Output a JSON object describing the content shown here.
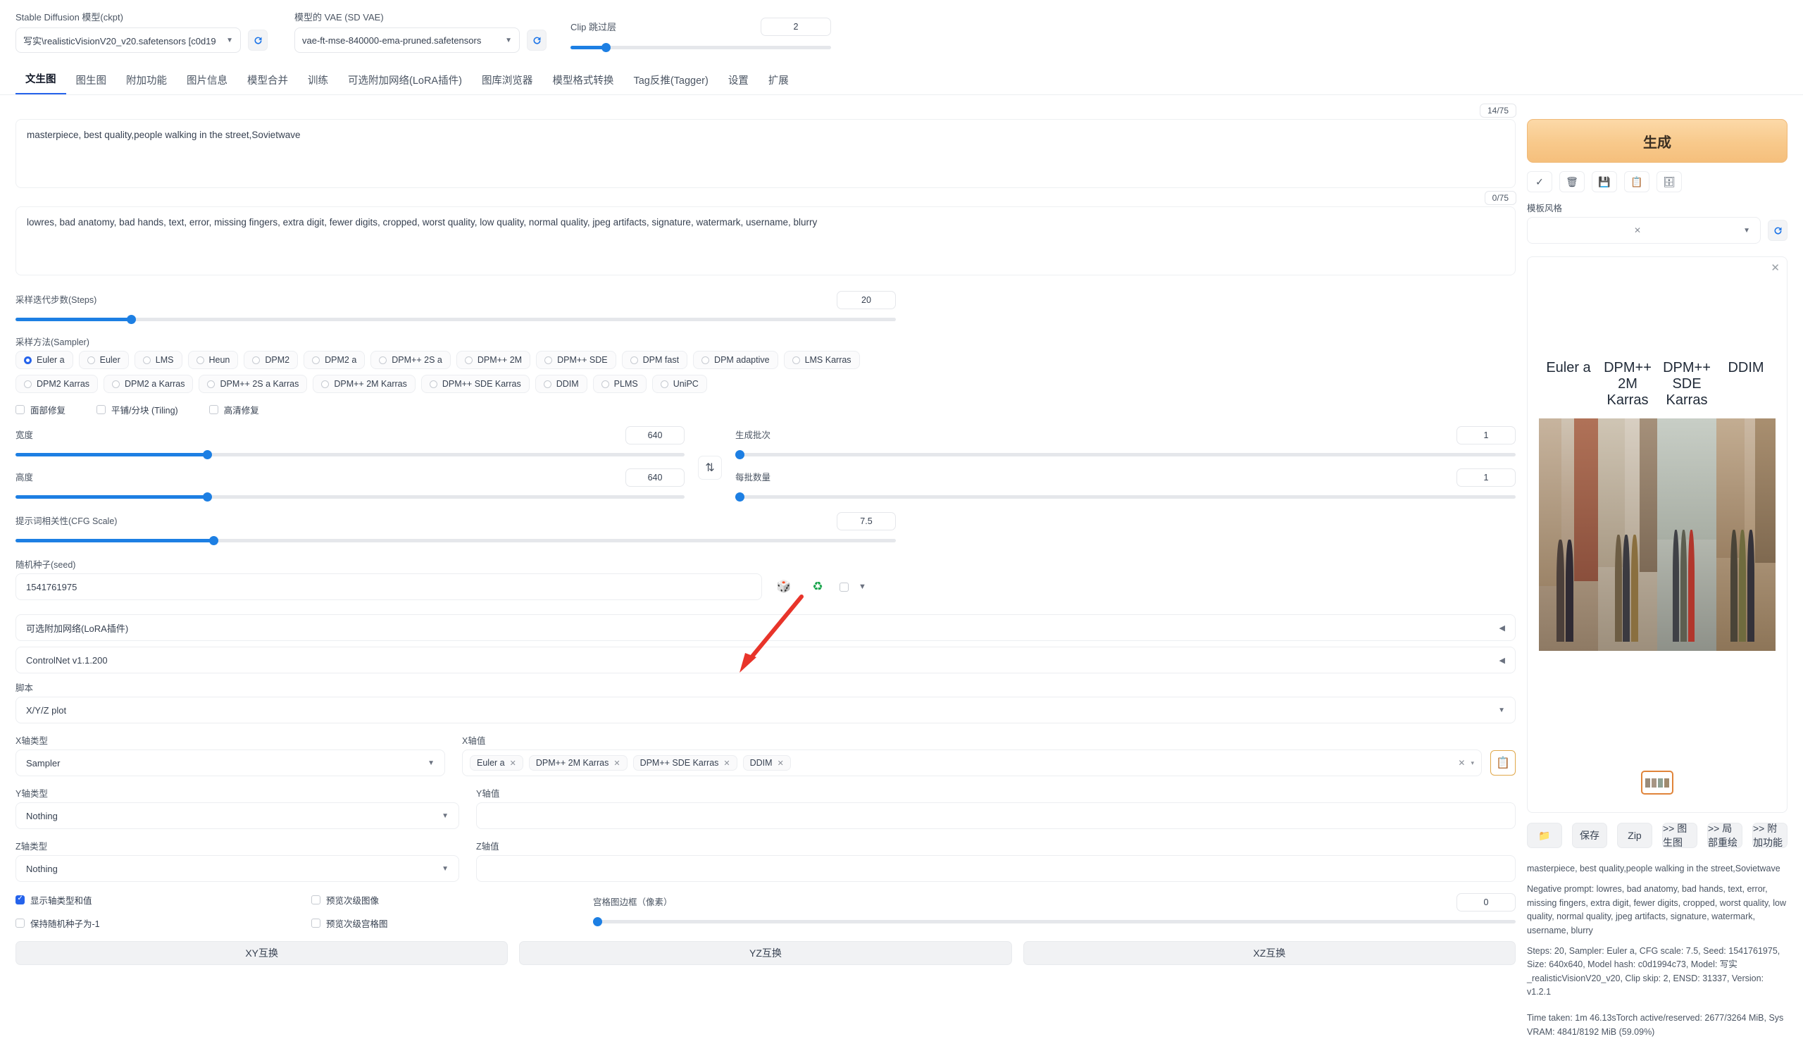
{
  "header": {
    "ckpt_label": "Stable Diffusion 模型(ckpt)",
    "ckpt_value": "写实\\realisticVisionV20_v20.safetensors [c0d19",
    "vae_label": "模型的 VAE (SD VAE)",
    "vae_value": "vae-ft-mse-840000-ema-pruned.safetensors",
    "clip_label": "Clip 跳过层",
    "clip_value": "2",
    "refresh_icon": "refresh-icon"
  },
  "tabs": [
    {
      "label": "文生图",
      "active": true
    },
    {
      "label": "图生图",
      "active": false
    },
    {
      "label": "附加功能",
      "active": false
    },
    {
      "label": "图片信息",
      "active": false
    },
    {
      "label": "模型合并",
      "active": false
    },
    {
      "label": "训练",
      "active": false
    },
    {
      "label": "可选附加网络(LoRA插件)",
      "active": false
    },
    {
      "label": "图库浏览器",
      "active": false
    },
    {
      "label": "模型格式转换",
      "active": false
    },
    {
      "label": "Tag反推(Tagger)",
      "active": false
    },
    {
      "label": "设置",
      "active": false
    },
    {
      "label": "扩展",
      "active": false
    }
  ],
  "prompt": {
    "positive": "masterpiece, best quality,people walking in the street,Sovietwave",
    "positive_tokens": "14/75",
    "negative": "lowres, bad anatomy, bad hands, text, error, missing fingers, extra digit, fewer digits, cropped, worst quality, low quality, normal quality, jpeg artifacts, signature, watermark, username, blurry",
    "negative_tokens": "0/75"
  },
  "params": {
    "steps_label": "采样迭代步数(Steps)",
    "steps_value": "20",
    "sampler_label": "采样方法(Sampler)",
    "samplers_row1": [
      "Euler a",
      "Euler",
      "LMS",
      "Heun",
      "DPM2",
      "DPM2 a",
      "DPM++ 2S a",
      "DPM++ 2M",
      "DPM++ SDE",
      "DPM fast",
      "DPM adaptive",
      "LMS Karras"
    ],
    "samplers_row2": [
      "DPM2 Karras",
      "DPM2 a Karras",
      "DPM++ 2S a Karras",
      "DPM++ 2M Karras",
      "DPM++ SDE Karras",
      "DDIM",
      "PLMS",
      "UniPC"
    ],
    "selected_sampler": "Euler a",
    "checkboxes": [
      {
        "label": "面部修复",
        "checked": false
      },
      {
        "label": "平铺/分块 (Tiling)",
        "checked": false
      },
      {
        "label": "高清修复",
        "checked": false
      }
    ],
    "width_label": "宽度",
    "width_value": "640",
    "height_label": "高度",
    "height_value": "640",
    "cfg_label": "提示词相关性(CFG Scale)",
    "cfg_value": "7.5",
    "batch_count_label": "生成批次",
    "batch_count_value": "1",
    "batch_size_label": "每批数量",
    "batch_size_value": "1",
    "swap_icon": "swap-arrows-icon",
    "seed_label": "随机种子(seed)",
    "seed_value": "1541761975",
    "dice_icon": "dice-icon",
    "recycle_icon": "recycle-icon",
    "extra_toggle_icon": "chevron-down-icon"
  },
  "accordions": [
    {
      "label": "可选附加网络(LoRA插件)",
      "arrow": "◀"
    },
    {
      "label": "ControlNet v1.1.200",
      "arrow": "◀"
    }
  ],
  "script": {
    "label": "脚本",
    "value": "X/Y/Z plot",
    "x_type_label": "X轴类型",
    "x_type_value": "Sampler",
    "x_values_label": "X轴值",
    "x_values": [
      "Euler a",
      "DPM++ 2M Karras",
      "DPM++ SDE Karras",
      "DDIM"
    ],
    "clear_all_icon": "clear-all-icon",
    "list_icon": "clipboard-icon",
    "y_type_label": "Y轴类型",
    "y_type_value": "Nothing",
    "y_values_label": "Y轴值",
    "y_values": "",
    "z_type_label": "Z轴类型",
    "z_type_value": "Nothing",
    "z_values_label": "Z轴值",
    "z_values": "",
    "options": [
      {
        "label": "显示轴类型和值",
        "checked": true
      },
      {
        "label": "保持随机种子为-1",
        "checked": false
      },
      {
        "label": "预览次级图像",
        "checked": false
      },
      {
        "label": "预览次级宫格图",
        "checked": false
      }
    ],
    "margin_label": "宫格图边框（像素）",
    "margin_value": "0",
    "swap_buttons": [
      "XY互换",
      "YZ互换",
      "XZ互换"
    ]
  },
  "output": {
    "generate_label": "生成",
    "style_label": "模板风格",
    "style_value": "",
    "style_clear_icon": "close-icon",
    "style_caret_icon": "chevron-down-icon",
    "style_refresh_icon": "refresh-icon",
    "toolbar_icons": [
      "check-icon",
      "trash-icon",
      "save-icon",
      "copy-icon",
      "archive-icon"
    ],
    "close_icon": "close-icon",
    "grid_labels": [
      "Euler a",
      "DPM++ 2M Karras",
      "DPM++ SDE Karras",
      "DDIM"
    ],
    "buttons": [
      {
        "label": "",
        "icon": "folder-icon"
      },
      {
        "label": "保存",
        "icon": ""
      },
      {
        "label": "Zip",
        "icon": ""
      },
      {
        "label": ">> 图生图",
        "icon": ""
      },
      {
        "label": ">> 局部重绘",
        "icon": ""
      },
      {
        "label": ">> 附加功能",
        "icon": ""
      }
    ],
    "info_prompt": "masterpiece, best quality,people walking in the street,Sovietwave",
    "info_negative": "Negative prompt: lowres, bad anatomy, bad hands, text, error, missing fingers, extra digit, fewer digits, cropped, worst quality, low quality, normal quality, jpeg artifacts, signature, watermark, username, blurry",
    "info_params": "Steps: 20, Sampler: Euler a, CFG scale: 7.5, Seed: 1541761975, Size: 640x640, Model hash: c0d1994c73, Model: 写实_realisticVisionV20_v20, Clip skip: 2, ENSD: 31337, Version: v1.2.1",
    "info_time": "Time taken: 1m 46.13sTorch active/reserved: 2677/3264 MiB, Sys VRAM: 4841/8192 MiB (59.09%)"
  },
  "colors": {
    "accent": "#2563eb",
    "slider": "#1d7fe3",
    "generate_bg": "#f8c98b",
    "arrow": "#e8342a"
  }
}
